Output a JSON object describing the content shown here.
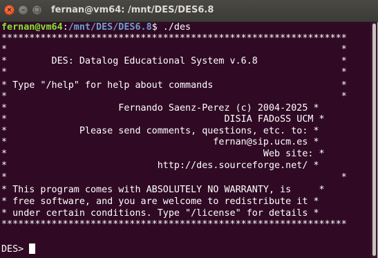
{
  "window": {
    "title": "fernan@vm64: /mnt/DES/DES6.8",
    "buttons": {
      "close_glyph": "×",
      "minimize_glyph": "–",
      "maximize_glyph": "□"
    }
  },
  "prompt": {
    "user_host": "fernan@vm64",
    "separator": ":",
    "path": "/mnt/DES/DES6.8",
    "symbol": "$",
    "command": " ./des"
  },
  "banner": [
    "**************************************************************",
    "*                                                            *",
    "*        DES: Datalog Educational System v.6.8               *",
    "*                                                            *",
    "* Type \"/help\" for help about commands                       *",
    "*                                                            *",
    "*                    Fernando Saenz-Perez (c) 2004-2025 *",
    "*                                       DISIA FADoSS UCM *",
    "*             Please send comments, questions, etc. to: *",
    "*                                     fernan@sip.ucm.es *",
    "*                                              Web site: *",
    "*                           http://des.sourceforge.net/ *",
    "*                                                            *",
    "* This program comes with ABSOLUTELY NO WARRANTY, is     *",
    "* free software, and you are welcome to redistribute it *",
    "* under certain conditions. Type \"/license\" for details *",
    "**************************************************************"
  ],
  "des_prompt": "DES> "
}
